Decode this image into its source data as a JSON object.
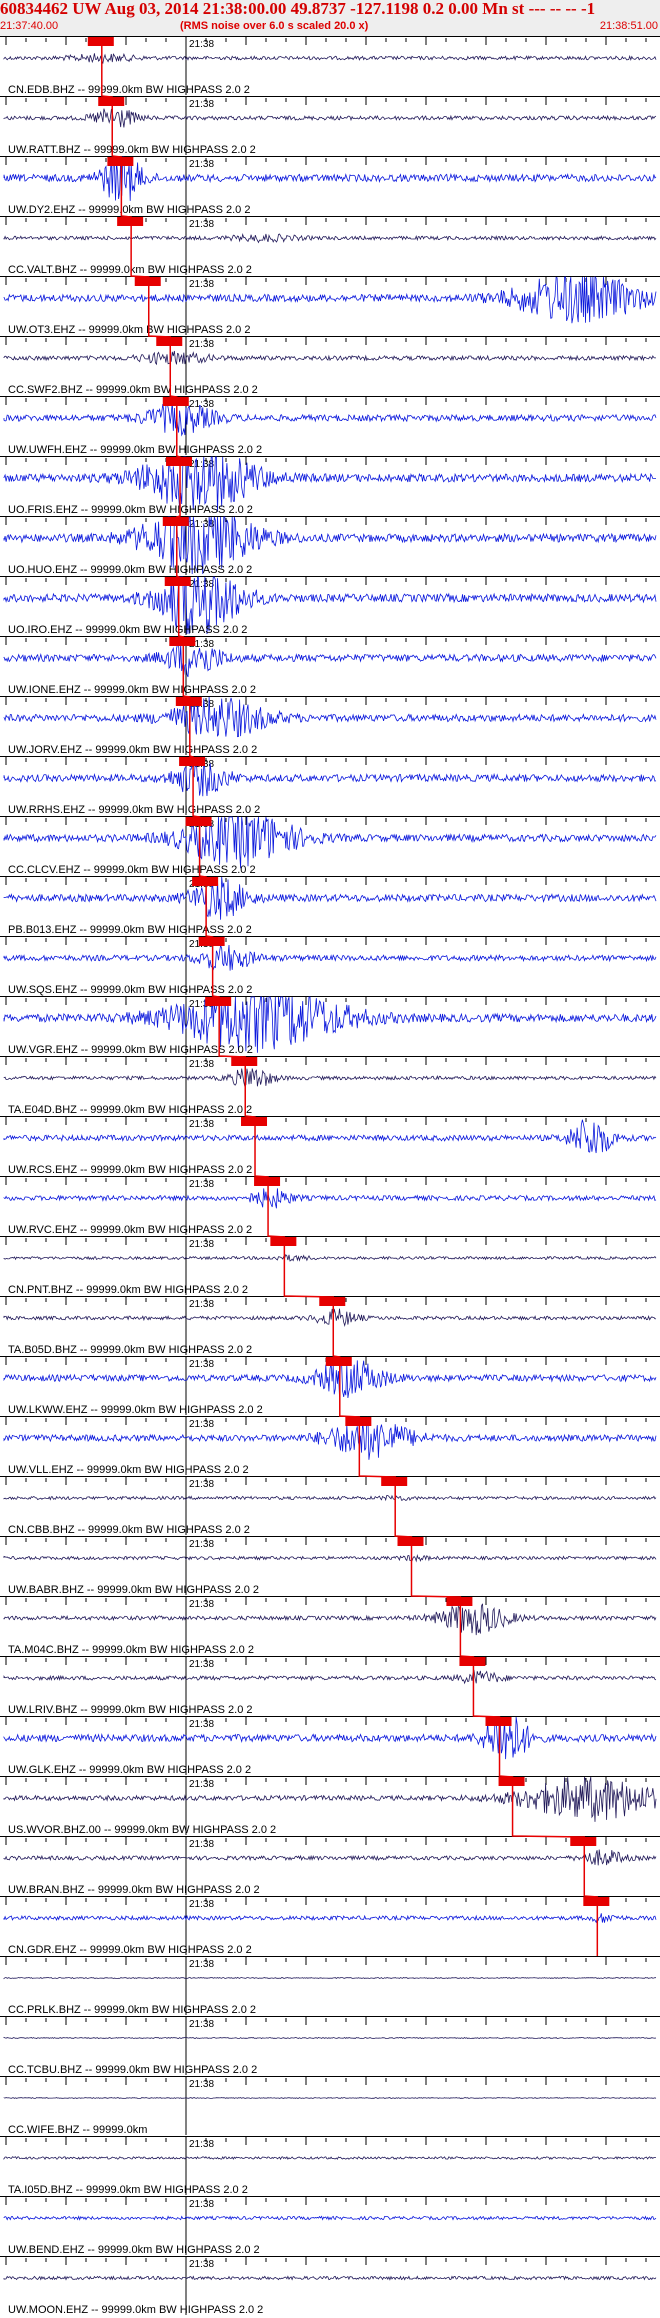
{
  "header": {
    "title": "60834462 UW Aug 03, 2014 21:38:00.00   49.8737 -127.1198  0.2 0.00 Mn st --- -- --  -1",
    "start_time": "21:37:40.00",
    "rms_note": "(RMS noise over 6.0 s scaled 20.0 x)",
    "end_time": "21:38:51.00",
    "title_color": "#d40000",
    "title_bg": "#eeeeee"
  },
  "colors": {
    "trace_blue": "#0b18dc",
    "trace_dark": "#221a5a",
    "pick_red": "#e60000",
    "grid": "#000000"
  },
  "minute_label": "21:38",
  "traces": [
    {
      "label": "CN.EDB.BHZ -- 99999.0km BW  HIGHPASS  2.0  2",
      "color": "dark",
      "amp": 0.45,
      "pick": 0.15,
      "burst": [
        0.15,
        0.05,
        0.6
      ]
    },
    {
      "label": "UW.RATT.BHZ -- 99999.0km BW  HIGHPASS  2.0  2",
      "color": "dark",
      "amp": 0.5,
      "pick": 0.166,
      "burst": [
        0.17,
        0.03,
        1.8
      ]
    },
    {
      "label": "UW.DY2.EHZ -- 99999.0km BW  HIGHPASS  2.0  2",
      "color": "blue",
      "amp": 0.9,
      "pick": 0.18,
      "burst": [
        0.18,
        0.03,
        2.2
      ]
    },
    {
      "label": "CC.VALT.BHZ -- 99999.0km BW  HIGHPASS  2.0  2",
      "color": "dark",
      "amp": 0.45,
      "pick": 0.195,
      "burst": [
        0.4,
        0.05,
        0.5
      ]
    },
    {
      "label": "UW.OT3.EHZ -- 99999.0km BW  HIGHPASS  2.0  2",
      "color": "blue",
      "amp": 0.9,
      "pick": 0.222,
      "burst": [
        0.88,
        0.09,
        2.3
      ]
    },
    {
      "label": "CC.SWF2.BHZ -- 99999.0km BW  HIGHPASS  2.0  2",
      "color": "dark",
      "amp": 0.55,
      "pick": 0.255,
      "burst": [
        0.26,
        0.05,
        0.8
      ]
    },
    {
      "label": "UW.UWFH.EHZ -- 99999.0km BW  HIGHPASS  2.0  2",
      "color": "blue",
      "amp": 0.8,
      "pick": 0.265,
      "burst": [
        0.27,
        0.05,
        1.5
      ]
    },
    {
      "label": "UO.FRIS.EHZ -- 99999.0km BW  HIGHPASS  2.0  2",
      "color": "blue",
      "amp": 1.0,
      "pick": 0.27,
      "burst": [
        0.3,
        0.08,
        2.8
      ]
    },
    {
      "label": "UO.HUO.EHZ -- 99999.0km BW  HIGHPASS  2.0  2",
      "color": "blue",
      "amp": 1.0,
      "pick": 0.265,
      "burst": [
        0.3,
        0.08,
        3.0
      ]
    },
    {
      "label": "UO.IRO.EHZ -- 99999.0km BW  HIGHPASS  2.0  2",
      "color": "blue",
      "amp": 1.0,
      "pick": 0.268,
      "burst": [
        0.3,
        0.06,
        3.2
      ]
    },
    {
      "label": "UW.IONE.EHZ -- 99999.0km BW  HIGHPASS  2.0  2",
      "color": "blue",
      "amp": 0.9,
      "pick": 0.275,
      "burst": [
        0.29,
        0.04,
        1.6
      ]
    },
    {
      "label": "UW.JORV.EHZ -- 99999.0km BW  HIGHPASS  2.0  2",
      "color": "blue",
      "amp": 0.9,
      "pick": 0.285,
      "burst": [
        0.33,
        0.07,
        1.8
      ]
    },
    {
      "label": "UW.RRHS.EHZ -- 99999.0km BW  HIGHPASS  2.0  2",
      "color": "blue",
      "amp": 0.9,
      "pick": 0.29,
      "burst": [
        0.3,
        0.04,
        1.5
      ]
    },
    {
      "label": "CC.CLCV.EHZ -- 99999.0km BW  HIGHPASS  2.0  2",
      "color": "blue",
      "amp": 0.9,
      "pick": 0.3,
      "burst": [
        0.36,
        0.08,
        2.6
      ]
    },
    {
      "label": "PB.B013.EHZ -- 99999.0km BW  HIGHPASS  2.0  2",
      "color": "blue",
      "amp": 0.9,
      "pick": 0.31,
      "burst": [
        0.33,
        0.04,
        1.8
      ]
    },
    {
      "label": "UW.SQS.EHZ -- 99999.0km BW  HIGHPASS  2.0  2",
      "color": "blue",
      "amp": 0.7,
      "pick": 0.32,
      "burst": [
        0.34,
        0.04,
        1.4
      ]
    },
    {
      "label": "UW.VGR.EHZ -- 99999.0km BW  HIGHPASS  2.0  2",
      "color": "blue",
      "amp": 1.0,
      "pick": 0.33,
      "burst": [
        0.39,
        0.12,
        2.8
      ]
    },
    {
      "label": "TA.E04D.BHZ -- 99999.0km BW  HIGHPASS  2.0  2",
      "color": "dark",
      "amp": 0.45,
      "pick": 0.37,
      "burst": [
        0.38,
        0.03,
        2.0
      ]
    },
    {
      "label": "UW.RCS.EHZ -- 99999.0km BW  HIGHPASS  2.0  2",
      "color": "blue",
      "amp": 0.7,
      "pick": 0.385,
      "burst": [
        0.9,
        0.03,
        2.4
      ]
    },
    {
      "label": "UW.RVC.EHZ -- 99999.0km BW  HIGHPASS  2.0  2",
      "color": "blue",
      "amp": 0.6,
      "pick": 0.405,
      "burst": [
        0.41,
        0.03,
        1.2
      ]
    },
    {
      "label": "CN.PNT.BHZ -- 99999.0km BW  HIGHPASS  2.0  2",
      "color": "dark",
      "amp": 0.35,
      "pick": 0.43,
      "burst": [
        0.44,
        0.03,
        0.5
      ]
    },
    {
      "label": "TA.B05D.BHZ -- 99999.0km BW  HIGHPASS  2.0  2",
      "color": "dark",
      "amp": 0.45,
      "pick": 0.505,
      "burst": [
        0.51,
        0.03,
        1.5
      ]
    },
    {
      "label": "UW.LKWW.EHZ -- 99999.0km BW  HIGHPASS  2.0  2",
      "color": "blue",
      "amp": 0.8,
      "pick": 0.515,
      "burst": [
        0.53,
        0.05,
        1.8
      ]
    },
    {
      "label": "UW.VLL.EHZ -- 99999.0km BW  HIGHPASS  2.0  2",
      "color": "blue",
      "amp": 0.8,
      "pick": 0.545,
      "burst": [
        0.56,
        0.06,
        2.0
      ]
    },
    {
      "label": "CN.CBB.BHZ -- 99999.0km BW  HIGHPASS  2.0  2",
      "color": "dark",
      "amp": 0.4,
      "pick": 0.6,
      "burst": [
        0.6,
        0.02,
        0.4
      ]
    },
    {
      "label": "UW.BABR.BHZ -- 99999.0km BW  HIGHPASS  2.0  2",
      "color": "dark",
      "amp": 0.4,
      "pick": 0.625,
      "burst": [
        0.63,
        0.02,
        0.4
      ]
    },
    {
      "label": "TA.M04C.BHZ -- 99999.0km BW  HIGHPASS  2.0  2",
      "color": "dark",
      "amp": 0.5,
      "pick": 0.7,
      "burst": [
        0.72,
        0.05,
        2.6
      ]
    },
    {
      "label": "UW.LRIV.BHZ -- 99999.0km BW  HIGHPASS  2.0  2",
      "color": "dark",
      "amp": 0.5,
      "pick": 0.72,
      "burst": [
        0.73,
        0.03,
        1.0
      ]
    },
    {
      "label": "UW.GLK.EHZ -- 99999.0km BW  HIGHPASS  2.0  2",
      "color": "blue",
      "amp": 0.9,
      "pick": 0.76,
      "burst": [
        0.77,
        0.03,
        2.8
      ]
    },
    {
      "label": "US.WVOR.BHZ.00 -- 99999.0km BW  HIGHPASS  2.0  2",
      "color": "dark",
      "amp": 0.6,
      "pick": 0.78,
      "burst": [
        0.9,
        0.1,
        3.0
      ]
    },
    {
      "label": "UW.BRAN.BHZ -- 99999.0km BW  HIGHPASS  2.0  2",
      "color": "dark",
      "amp": 0.5,
      "pick": 0.89,
      "burst": [
        0.92,
        0.03,
        1.2
      ]
    },
    {
      "label": "CN.GDR.EHZ -- 99999.0km BW  HIGHPASS  2.0  2",
      "color": "blue",
      "amp": 0.5,
      "pick": 0.91,
      "burst": [
        0.92,
        0.02,
        0.6
      ]
    },
    {
      "label": "CC.PRLK.BHZ -- 99999.0km BW  HIGHPASS  2.0  2",
      "color": "dark",
      "amp": 0.12,
      "pick": null,
      "burst": null
    },
    {
      "label": "CC.TCBU.BHZ -- 99999.0km BW  HIGHPASS  2.0  2",
      "color": "dark",
      "amp": 0.12,
      "pick": null,
      "burst": null
    },
    {
      "label": "CC.WIFE.BHZ -- 99999.0km",
      "color": "dark",
      "amp": 0.1,
      "pick": null,
      "burst": null
    },
    {
      "label": "TA.I05D.BHZ -- 99999.0km BW  HIGHPASS  2.0  2",
      "color": "dark",
      "amp": 0.3,
      "pick": null,
      "burst": null
    },
    {
      "label": "UW.BEND.EHZ -- 99999.0km BW  HIGHPASS  2.0  2",
      "color": "blue",
      "amp": 0.4,
      "pick": null,
      "burst": null
    },
    {
      "label": "UW.MOON.EHZ -- 99999.0km BW  HIGHPASS  2.0  2",
      "color": "dark",
      "amp": 0.4,
      "pick": null,
      "burst": null
    }
  ]
}
